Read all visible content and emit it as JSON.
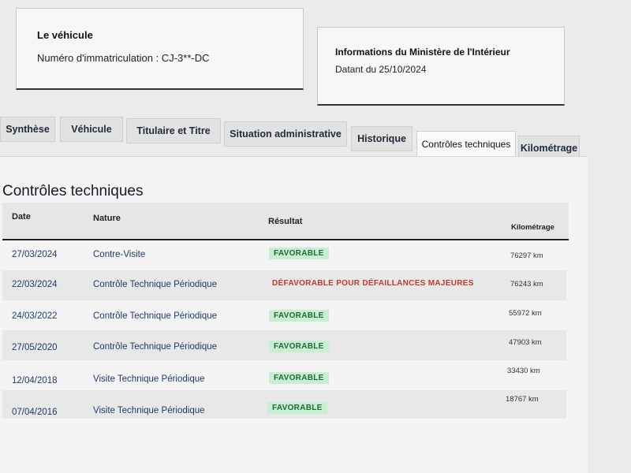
{
  "vehicle_card": {
    "title": "Le véhicule",
    "plate_text": "Numéro d'immatriculation : CJ-3**-DC"
  },
  "ministry_card": {
    "title": "Informations du Ministère de l'Intérieur",
    "date_text": "Datant du 25/10/2024"
  },
  "tabs": [
    {
      "label": "Synthèse"
    },
    {
      "label": "Véhicule"
    },
    {
      "label": "Titulaire et Titre"
    },
    {
      "label": "Situation administrative"
    },
    {
      "label": "Historique"
    },
    {
      "label": "Contrôles techniques",
      "active": true
    },
    {
      "label": "Kilométrage"
    }
  ],
  "section": {
    "title": "Contrôles techniques",
    "columns": {
      "date": "Date",
      "nature": "Nature",
      "result": "Résultat",
      "mileage": "Kilométrage"
    },
    "rows": [
      {
        "date": "27/03/2024",
        "nature": "Contre-Visite",
        "result": "FAVORABLE",
        "status": "ok",
        "mileage": "76297 km"
      },
      {
        "date": "22/03/2024",
        "nature": "Contrôle Technique Périodique",
        "result": "DÉFAVORABLE POUR DÉFAILLANCES MAJEURES",
        "status": "ko",
        "mileage": "76243 km"
      },
      {
        "date": "24/03/2022",
        "nature": "Contrôle Technique Périodique",
        "result": "FAVORABLE",
        "status": "ok",
        "mileage": "55972 km"
      },
      {
        "date": "27/05/2020",
        "nature": "Contrôle Technique Périodique",
        "result": "FAVORABLE",
        "status": "ok",
        "mileage": "47903 km"
      },
      {
        "date": "12/04/2018",
        "nature": "Visite Technique Périodique",
        "result": "FAVORABLE",
        "status": "ok",
        "mileage": "33430 km"
      },
      {
        "date": "07/04/2016",
        "nature": "Visite Technique Périodique",
        "result": "FAVORABLE",
        "status": "ok",
        "mileage": "18767 km"
      }
    ]
  },
  "colors": {
    "favorable_bg": "#c8efd2",
    "favorable_text": "#1e6b34",
    "defavorable_text": "#c0392b"
  }
}
